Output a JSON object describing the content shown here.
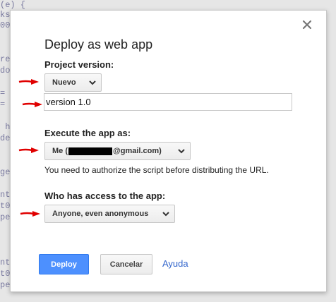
{
  "background_code": [
    "(e) {",
    "ks",
    "00",
    "",
    "re",
    "do",
    "",
    "=",
    "=",
    "",
    " h",
    "de",
    "",
    "ge",
    "",
    "nt",
    "t0",
    "pe",
    "",
    "",
    "nt",
    "t0",
    "pe"
  ],
  "dialog": {
    "title": "Deploy as web app",
    "close_icon": "close-icon",
    "project_version": {
      "label": "Project version:",
      "select_value": "Nuevo",
      "input_value": "version 1.0"
    },
    "execute_as": {
      "label": "Execute the app as:",
      "select_prefix": "Me (",
      "select_suffix": "@gmail.com)",
      "help_text": "You need to authorize the script before distributing the URL."
    },
    "access": {
      "label": "Who has access to the app:",
      "select_value": "Anyone, even anonymous"
    },
    "buttons": {
      "deploy": "Deploy",
      "cancel": "Cancelar",
      "help_link": "Ayuda"
    }
  },
  "colors": {
    "primary_button": "#4d90fe",
    "link": "#3366cc",
    "annotation_arrow": "#e00000"
  }
}
